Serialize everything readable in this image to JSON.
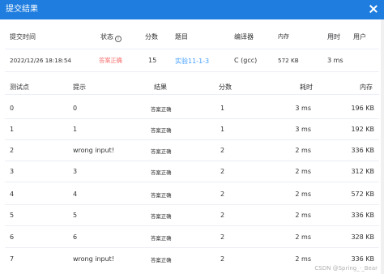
{
  "dialog": {
    "title": "提交结果"
  },
  "submission": {
    "headers": {
      "time": "提交时间",
      "status": "状态",
      "score": "分数",
      "problem": "题目",
      "compiler": "编译器",
      "memory": "内存",
      "time_used": "用时",
      "user": "用户"
    },
    "values": {
      "time": "2022/12/26 18:18:54",
      "status": "答案正确",
      "score": "15",
      "problem": "实验11-1-3",
      "compiler": "C (gcc)",
      "memory": "572 KB",
      "time_used": "3 ms",
      "user": ""
    }
  },
  "tests": {
    "headers": {
      "id": "测试点",
      "hint": "提示",
      "result": "结果",
      "score": "分数",
      "time": "耗时",
      "memory": "内存"
    },
    "rows": [
      {
        "id": "0",
        "hint": "0",
        "result": "答案正确",
        "score": "1",
        "time": "3 ms",
        "memory": "196 KB"
      },
      {
        "id": "1",
        "hint": "1",
        "result": "答案正确",
        "score": "1",
        "time": "3 ms",
        "memory": "192 KB"
      },
      {
        "id": "2",
        "hint": "wrong input!",
        "result": "答案正确",
        "score": "2",
        "time": "2 ms",
        "memory": "336 KB"
      },
      {
        "id": "3",
        "hint": "3",
        "result": "答案正确",
        "score": "2",
        "time": "2 ms",
        "memory": "312 KB"
      },
      {
        "id": "4",
        "hint": "4",
        "result": "答案正确",
        "score": "2",
        "time": "2 ms",
        "memory": "572 KB"
      },
      {
        "id": "5",
        "hint": "5",
        "result": "答案正确",
        "score": "2",
        "time": "2 ms",
        "memory": "336 KB"
      },
      {
        "id": "6",
        "hint": "6",
        "result": "答案正确",
        "score": "2",
        "time": "2 ms",
        "memory": "328 KB"
      },
      {
        "id": "7",
        "hint": "wrong input!",
        "result": "答案正确",
        "score": "2",
        "time": "2 ms",
        "memory": "336 KB"
      }
    ]
  },
  "watermark": "CSDN @Spring_-_Bear",
  "colors": {
    "header_bg": "#1e7ddf",
    "accepted": "#f56c6c",
    "link": "#409eff"
  }
}
